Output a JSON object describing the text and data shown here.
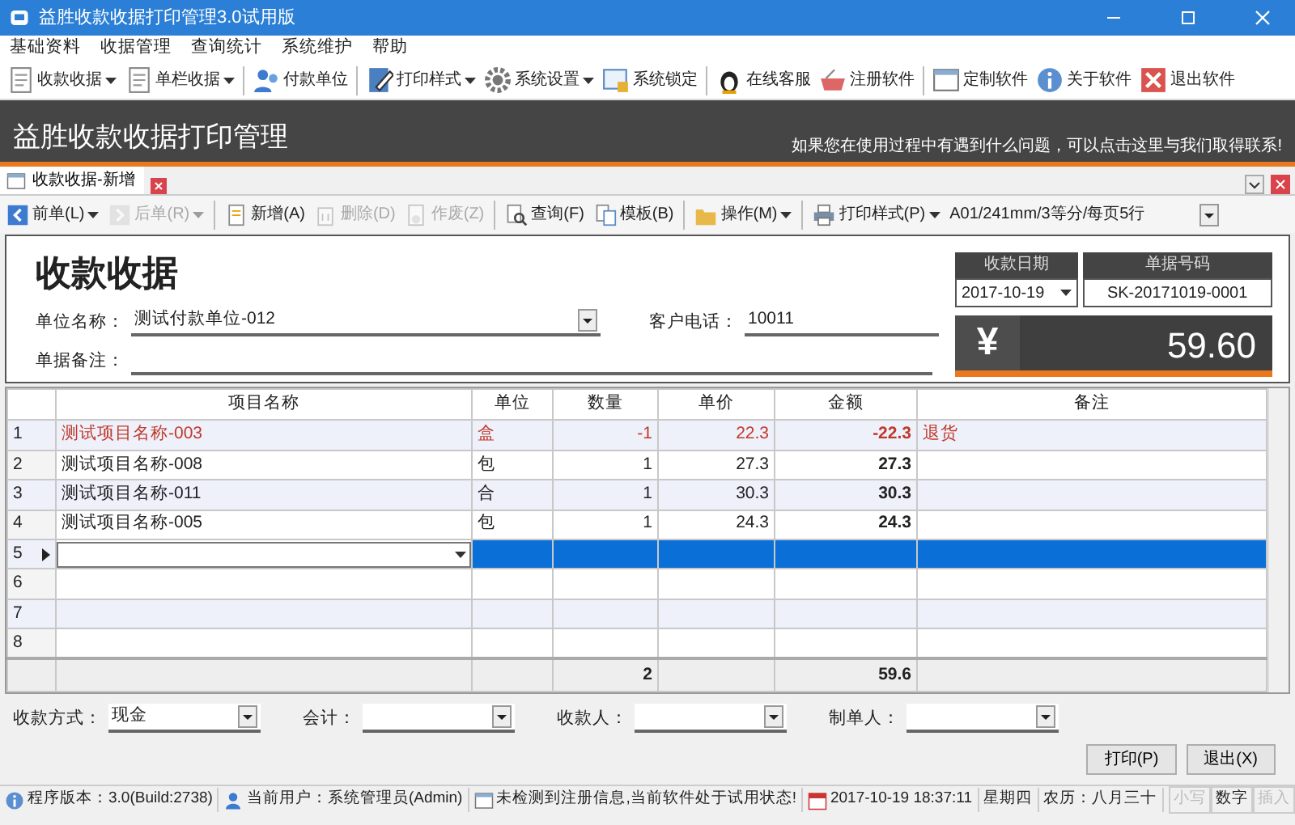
{
  "window": {
    "title": "益胜收款收据打印管理3.0试用版"
  },
  "menu": [
    "基础资料",
    "收据管理",
    "查询统计",
    "系统维护",
    "帮助"
  ],
  "toolbar": [
    {
      "label": "收款收据",
      "dropdown": true
    },
    {
      "label": "单栏收据",
      "dropdown": true
    },
    {
      "label": "付款单位",
      "dropdown": false
    },
    {
      "label": "打印样式",
      "dropdown": true
    },
    {
      "label": "系统设置",
      "dropdown": true
    },
    {
      "label": "系统锁定",
      "dropdown": false
    },
    {
      "label": "在线客服",
      "dropdown": false
    },
    {
      "label": "注册软件",
      "dropdown": false
    },
    {
      "label": "定制软件",
      "dropdown": false
    },
    {
      "label": "关于软件",
      "dropdown": false
    },
    {
      "label": "退出软件",
      "dropdown": false
    }
  ],
  "banner": {
    "title": "益胜收款收据打印管理",
    "help_link": "如果您在使用过程中有遇到什么问题，可以点击这里与我们取得联系!"
  },
  "tabs": [
    {
      "label": "收款收据-新增",
      "selected": true
    }
  ],
  "doc_toolbar": [
    {
      "label": "前单(L)",
      "disabled": false,
      "dropdown": true
    },
    {
      "label": "后单(R)",
      "disabled": true,
      "dropdown": true
    },
    {
      "label": "新增(A)",
      "disabled": false,
      "dropdown": false
    },
    {
      "label": "删除(D)",
      "disabled": true,
      "dropdown": false
    },
    {
      "label": "作废(Z)",
      "disabled": true,
      "dropdown": false
    },
    {
      "label": "查询(F)",
      "disabled": false,
      "dropdown": false
    },
    {
      "label": "模板(B)",
      "disabled": false,
      "dropdown": false
    },
    {
      "label": "操作(M)",
      "disabled": false,
      "dropdown": true
    },
    {
      "label": "打印样式(P)",
      "disabled": false,
      "dropdown": true
    }
  ],
  "print_style": {
    "value": "A01/241mm/3等分/每页5行"
  },
  "form": {
    "title": "收款收据",
    "fields": [
      {
        "label": "单位名称：",
        "value": "测试付款单位-012",
        "kind": "select"
      },
      {
        "label": "客户电话：",
        "value": "10011",
        "kind": "text"
      },
      {
        "label": "单据备注：",
        "kind": "text"
      }
    ],
    "date": {
      "label": "收款日期",
      "value": "2017-10-19"
    },
    "number": {
      "label": "单据号码",
      "value": "SK-20171019-0001"
    },
    "total": {
      "symbol": "¥",
      "value": "59.60"
    }
  },
  "table": {
    "columns": [
      "项目名称",
      "单位",
      "数量",
      "单价",
      "金额",
      "备注"
    ],
    "rows": [
      {
        "index": "1",
        "kind": "return",
        "selected": false,
        "cells": [
          "测试项目名称-003",
          "盒",
          "-1",
          "22.3",
          "-22.3",
          "退货"
        ]
      },
      {
        "index": "2",
        "kind": "normal",
        "selected": false,
        "cells": [
          "测试项目名称-008",
          "包",
          "1",
          "27.3",
          "27.3"
        ]
      },
      {
        "index": "3",
        "kind": "normal",
        "selected": false,
        "cells": [
          "测试项目名称-011",
          "合",
          "1",
          "30.3",
          "30.3"
        ]
      },
      {
        "index": "4",
        "kind": "normal",
        "selected": false,
        "cells": [
          "测试项目名称-005",
          "包",
          "1",
          "24.3",
          "24.3"
        ]
      },
      {
        "index": "5",
        "kind": "normal",
        "selected": true,
        "cells": []
      },
      {
        "index": "6",
        "kind": "normal",
        "selected": false,
        "cells": []
      },
      {
        "index": "7",
        "kind": "normal",
        "selected": false,
        "cells": []
      },
      {
        "index": "8",
        "kind": "normal",
        "selected": false,
        "cells": []
      }
    ],
    "totals": {
      "quantity": "2",
      "amount": "59.6"
    }
  },
  "footer_fields": [
    {
      "label": "收款方式：",
      "value": "现金"
    },
    {
      "label": "会计："
    },
    {
      "label": "收款人："
    },
    {
      "label": "制单人："
    }
  ],
  "buttons": [
    "打印(P)",
    "退出(X)"
  ],
  "status_bar": [
    "程序版本：3.0(Build:2738)",
    "当前用户：系统管理员(Admin)",
    "未检测到注册信息,当前软件处于试用状态!",
    "2017-10-19 18:37:11",
    "星期四",
    "农历：八月三十"
  ],
  "indicators": [
    {
      "label": "小写",
      "on": false
    },
    {
      "label": "数字",
      "on": true
    },
    {
      "label": "插入",
      "on": false
    }
  ]
}
